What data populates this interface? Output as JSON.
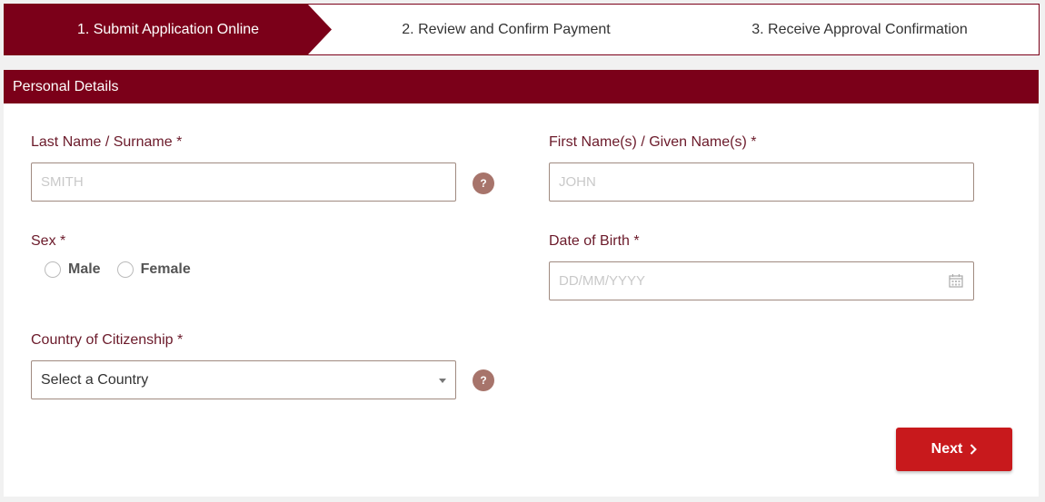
{
  "steps": [
    {
      "label": "1. Submit Application Online"
    },
    {
      "label": "2. Review and Confirm Payment"
    },
    {
      "label": "3. Receive Approval Confirmation"
    }
  ],
  "panel": {
    "title": "Personal Details"
  },
  "form": {
    "last_name": {
      "label": "Last Name / Surname *",
      "placeholder": "SMITH",
      "help": "?"
    },
    "first_name": {
      "label": "First Name(s) / Given Name(s) *",
      "placeholder": "JOHN"
    },
    "sex": {
      "label": "Sex *",
      "options": [
        "Male",
        "Female"
      ]
    },
    "dob": {
      "label": "Date of Birth *",
      "placeholder": "DD/MM/YYYY"
    },
    "country": {
      "label": "Country of Citizenship *",
      "selected": "Select a Country",
      "help": "?"
    }
  },
  "actions": {
    "next_label": "Next"
  },
  "colors": {
    "brand": "#7b0019",
    "button": "#c8191c",
    "help": "#a7746b"
  }
}
